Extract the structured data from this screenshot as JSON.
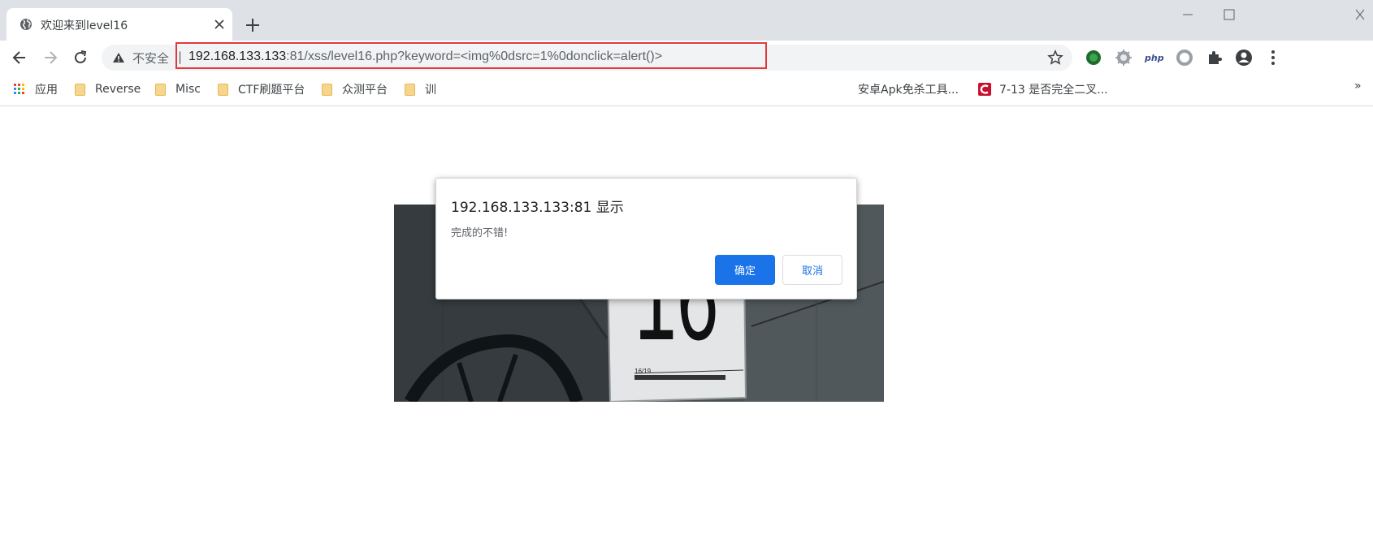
{
  "tab": {
    "title": "欢迎来到level16",
    "favicon": "globe-icon"
  },
  "omnibox": {
    "security_label": "不安全",
    "separator": "|",
    "url_host": "192.168.133.133",
    "url_rest": ":81/xss/level16.php?keyword=<img%0dsrc=1%0donclick=alert()>"
  },
  "bookmarks": {
    "apps_label": "应用",
    "items": [
      "Reverse",
      "Misc",
      "CTF刷题平台",
      "众测平台",
      "训"
    ],
    "item_apk": "安卓Apk免杀工具...",
    "item_cto": "7-13 是否完全二叉...",
    "more": "»"
  },
  "dialog": {
    "title": "192.168.133.133:81 显示",
    "message": "完成的不错!",
    "ok_label": "确定",
    "cancel_label": "取消"
  },
  "content": {
    "sign_number": "16",
    "sign_caption": "16/19"
  },
  "colors": {
    "accent": "#1a73e8",
    "highlight_border": "#e0383e",
    "tabstrip": "#dee1e6"
  }
}
